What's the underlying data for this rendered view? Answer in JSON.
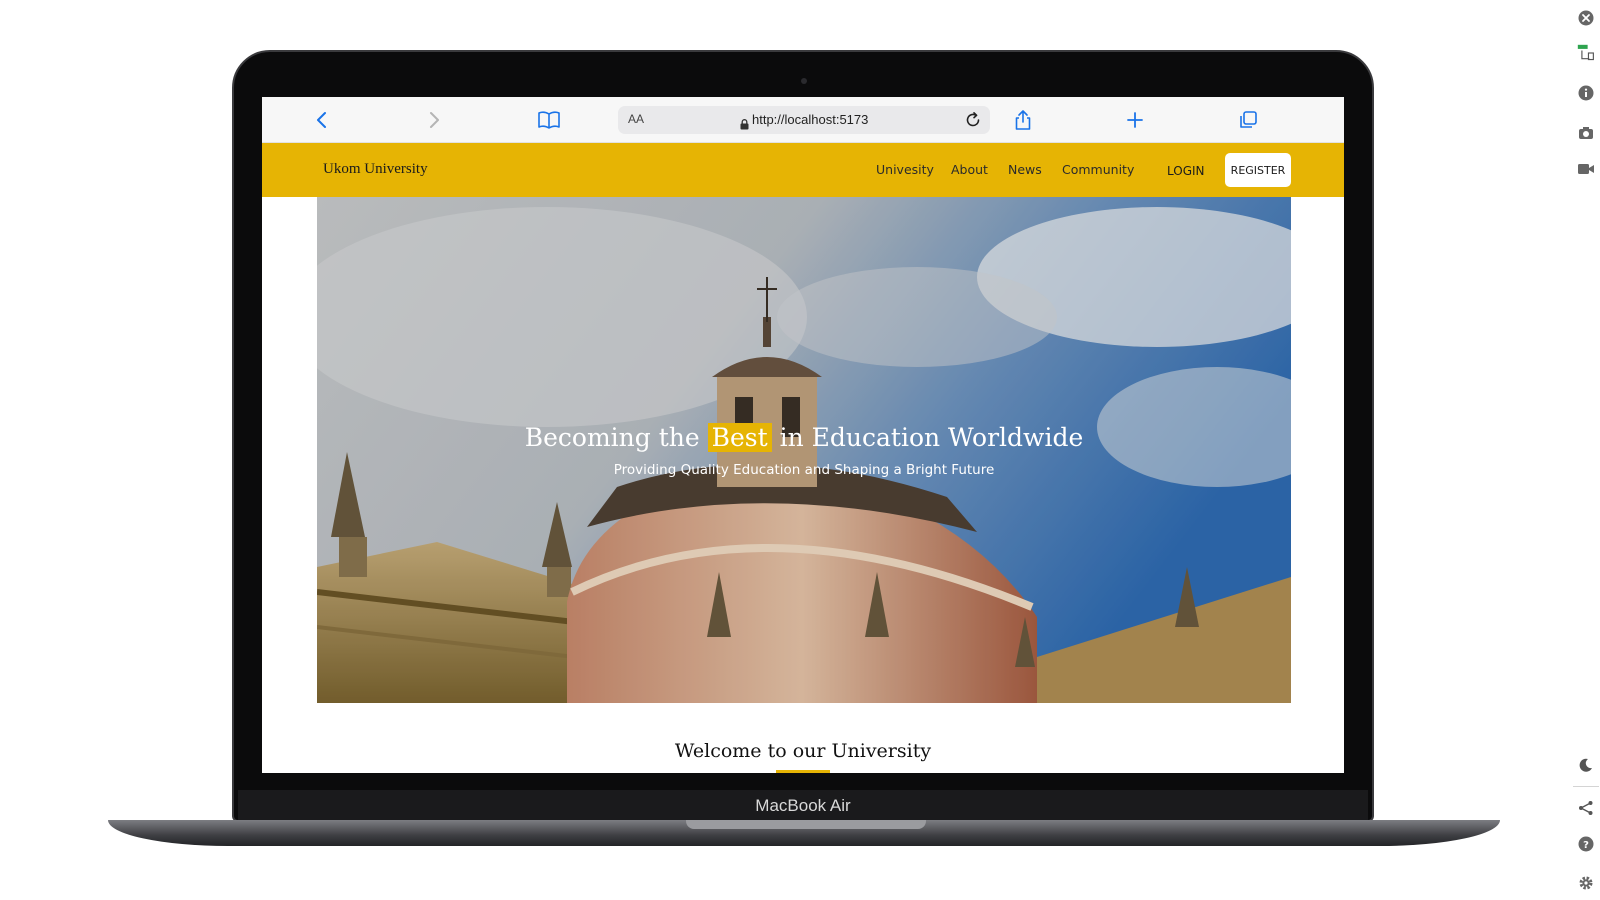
{
  "device": {
    "model_label": "MacBook Air"
  },
  "browser": {
    "text_size_label": "AA",
    "url": "http://localhost:5173",
    "icons": [
      "back-icon",
      "forward-icon",
      "bookmarks-icon",
      "lock-icon",
      "reload-icon",
      "share-icon",
      "new-tab-icon",
      "tabs-icon"
    ]
  },
  "site": {
    "brand": "Ukom University",
    "nav": [
      {
        "label": "Univesity"
      },
      {
        "label": "About"
      },
      {
        "label": "News"
      },
      {
        "label": "Community"
      }
    ],
    "login_label": "LOGIN",
    "register_label": "REGISTER",
    "accent_color": "#e6b404"
  },
  "hero": {
    "title_before": "Becoming the",
    "title_highlight": "Best",
    "title_after": "in Education Worldwide",
    "subtitle": "Providing Quality Education and Shaping a Bright Future"
  },
  "welcome": {
    "heading": "Welcome to our University"
  },
  "side_rail": {
    "icons": [
      "close-icon",
      "responsive-icon",
      "info-icon",
      "camera-icon",
      "video-icon",
      "dark-mode-icon",
      "share-icon",
      "help-icon",
      "settings-icon"
    ]
  }
}
